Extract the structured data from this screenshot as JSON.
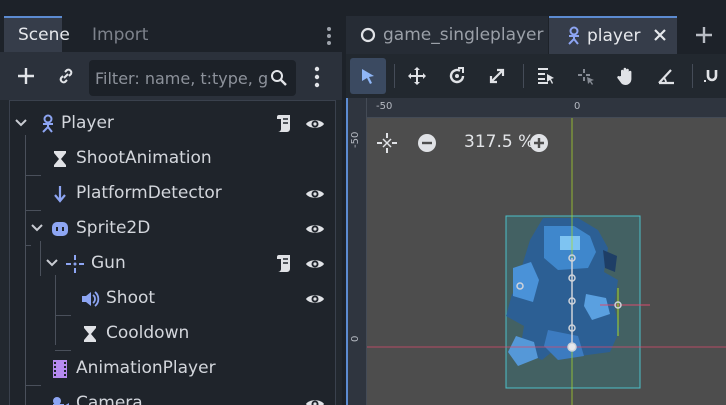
{
  "dock": {
    "tabs": [
      {
        "label": "Scene"
      },
      {
        "label": "Import"
      }
    ],
    "filter_placeholder": "Filter: name, t:type, g"
  },
  "tree": {
    "nodes": [
      {
        "label": "Player",
        "icon": "character-body-icon",
        "expanded": true,
        "script": true,
        "visible": true
      },
      {
        "label": "ShootAnimation",
        "icon": "timer-hourglass-icon",
        "visible": false
      },
      {
        "label": "PlatformDetector",
        "icon": "raycast-arrow-icon",
        "visible": true
      },
      {
        "label": "Sprite2D",
        "icon": "sprite-icon",
        "expanded": true,
        "visible": true
      },
      {
        "label": "Gun",
        "icon": "marker-crosshair-icon",
        "expanded": true,
        "script": true,
        "visible": true
      },
      {
        "label": "Shoot",
        "icon": "audio-speaker-icon",
        "visible": true
      },
      {
        "label": "Cooldown",
        "icon": "timer-hourglass-icon",
        "visible": false
      },
      {
        "label": "AnimationPlayer",
        "icon": "film-strip-icon",
        "visible": false
      },
      {
        "label": "Camera",
        "icon": "camera-icon",
        "visible": true
      }
    ]
  },
  "editor": {
    "tabs": [
      {
        "label": "game_singleplayer",
        "icon": "scene-circle-icon"
      },
      {
        "label": "player",
        "icon": "character-body-icon",
        "active": true
      }
    ],
    "zoom_label": "317.5 %",
    "ruler": {
      "h": [
        "-50",
        "0"
      ],
      "v": [
        "-50",
        "0"
      ]
    }
  },
  "colors": {
    "accent": "#5c8bd1",
    "icon_blue": "#8da5f3",
    "sprite_blue": "#4f8fd6"
  }
}
